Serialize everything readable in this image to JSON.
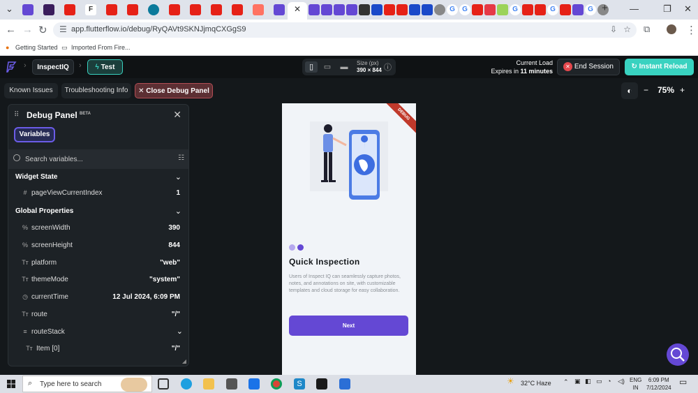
{
  "browser": {
    "url": "app.flutterflow.io/debug/RyQAVt9SKNJjmqCXGgS9",
    "bookmarks": [
      "Getting Started",
      "Imported From Fire..."
    ]
  },
  "header": {
    "project_name": "InspectIQ",
    "mode_label": "Test",
    "size_label": "Size (px)",
    "size_value": "390 × 844",
    "current_load_label": "Current Load",
    "expires_prefix": "Expires in",
    "expires_value": "11 minutes",
    "end_session_label": "End Session",
    "instant_reload_label": "Instant Reload"
  },
  "toolbar": {
    "known_issues": "Known Issues",
    "troubleshooting": "Troubleshooting Info",
    "close_debug": "Close Debug Panel",
    "zoom": "75%"
  },
  "debug_panel": {
    "title": "Debug Panel",
    "badge": "BETA",
    "tab": "Variables",
    "search_placeholder": "Search variables...",
    "widget_state_title": "Widget State",
    "global_properties_title": "Global Properties",
    "rows": [
      {
        "icon": "#",
        "name": "pageViewCurrentIndex",
        "value": "1"
      },
      {
        "icon": "%",
        "name": "screenWidth",
        "value": "390"
      },
      {
        "icon": "%",
        "name": "screenHeight",
        "value": "844"
      },
      {
        "icon": "Tт",
        "name": "platform",
        "value": "\"web\""
      },
      {
        "icon": "Tт",
        "name": "themeMode",
        "value": "\"system\""
      },
      {
        "icon": "◷",
        "name": "currentTime",
        "value": "12 Jul 2024, 6:09 PM"
      },
      {
        "icon": "Tт",
        "name": "route",
        "value": "\"/\""
      },
      {
        "icon": "≡",
        "name": "routeStack",
        "value": ""
      },
      {
        "icon": "Tт",
        "name": "Item [0]",
        "value": "\"/\""
      }
    ]
  },
  "preview": {
    "ribbon": "DEBUG",
    "heading": "Quick Inspection",
    "description": "Users of Inspect IQ can seamlessly capture photos, notes, and annotations on site, with customizable templates and cloud storage for easy collaboration.",
    "next_label": "Next",
    "dot_colors": [
      "#b5a8ee",
      "#6448d4"
    ]
  },
  "taskbar": {
    "search_placeholder": "Type here to search",
    "weather": "32°C Haze",
    "lang1": "ENG",
    "lang2": "IN",
    "time": "6:09 PM",
    "date": "7/12/2024"
  },
  "colors": {
    "accent": "#6448d4",
    "teal": "#39d2c0",
    "danger": "#e5484d"
  }
}
